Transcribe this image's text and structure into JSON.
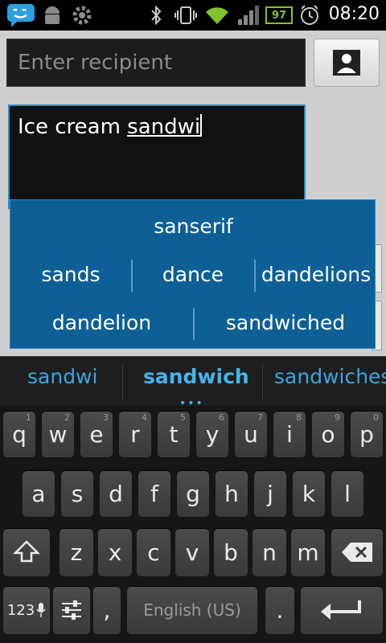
{
  "status": {
    "time": "08:20",
    "battery": "97"
  },
  "recipient": {
    "placeholder": "Enter recipient"
  },
  "message": {
    "text_prefix": "Ice cream ",
    "text_word": "sandwi"
  },
  "popup": {
    "row1": [
      "sanserif"
    ],
    "row2": [
      "sands",
      "dance",
      "dandelions"
    ],
    "row3": [
      "dandelion",
      "sandwiched"
    ]
  },
  "suggestions": {
    "left": "sandwi",
    "center": "sandwich",
    "right": "sandwiches"
  },
  "keys": {
    "row1": [
      {
        "k": "q",
        "h": "1"
      },
      {
        "k": "w",
        "h": "2"
      },
      {
        "k": "e",
        "h": "3"
      },
      {
        "k": "r",
        "h": "4"
      },
      {
        "k": "t",
        "h": "5"
      },
      {
        "k": "y",
        "h": "6"
      },
      {
        "k": "u",
        "h": "7"
      },
      {
        "k": "i",
        "h": "8"
      },
      {
        "k": "o",
        "h": "9"
      },
      {
        "k": "p",
        "h": "0"
      }
    ],
    "row2": [
      "a",
      "s",
      "d",
      "f",
      "g",
      "h",
      "j",
      "k",
      "l"
    ],
    "row3": [
      "z",
      "x",
      "c",
      "v",
      "b",
      "n",
      "m"
    ],
    "mode": "123",
    "comma": ",",
    "space": "English (US)",
    "period": "."
  }
}
